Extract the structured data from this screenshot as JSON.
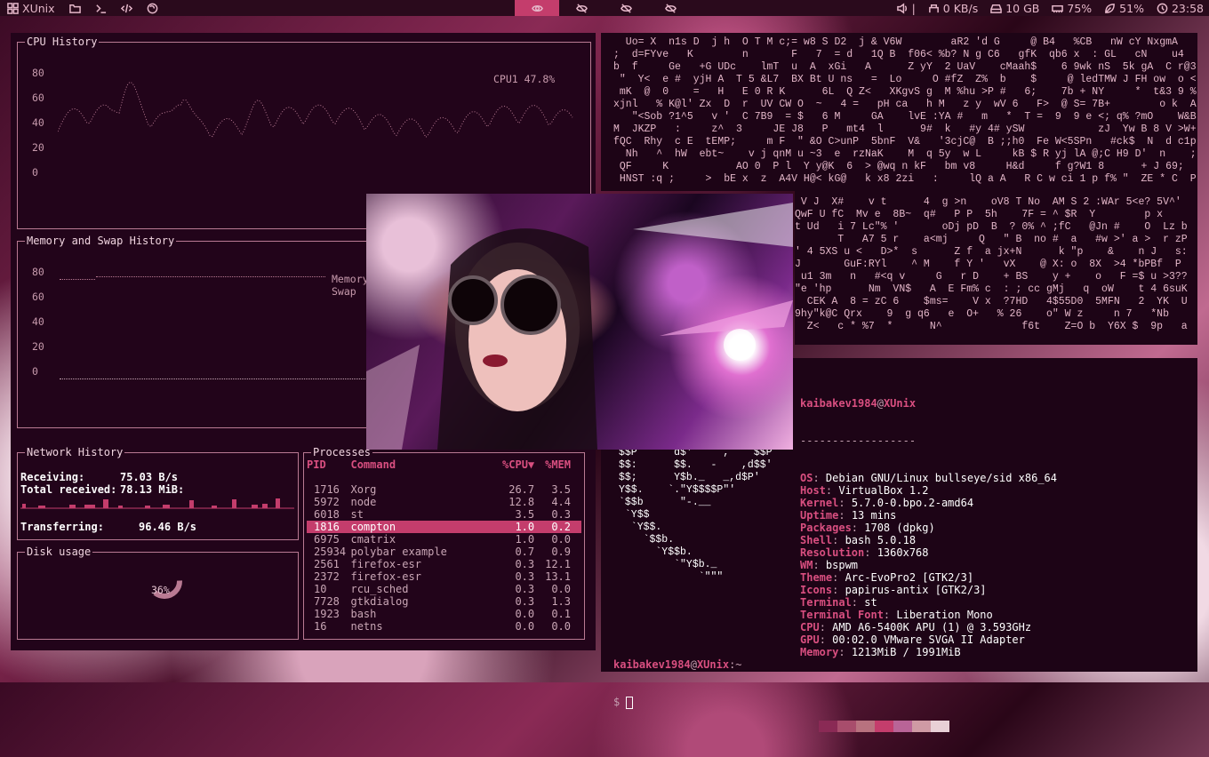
{
  "topbar": {
    "app_name": "XUnix",
    "right": {
      "volume_sep": "|",
      "net": "0 KB/s",
      "disk": "10 GB",
      "mem": "75%",
      "cpu": "51%",
      "clock": "23:58"
    }
  },
  "cpu": {
    "title": "CPU History",
    "label": "CPU1  47.8%",
    "yticks": [
      "80",
      "60",
      "40",
      "20",
      "0"
    ]
  },
  "memory": {
    "title": "Memory and Swap History",
    "legend_memory": "Memory",
    "legend_swap": "Swap",
    "yticks": [
      "80",
      "60",
      "40",
      "20",
      "0"
    ]
  },
  "network": {
    "title": "Network History",
    "receiving_label": "Receiving:",
    "receiving_value": "75.03  B/s",
    "total_label": "Total received:",
    "total_value": "78.13 MiB:",
    "transferring_label": "Transferring:",
    "transferring_value": "96.46  B/s"
  },
  "disk": {
    "title": "Disk usage",
    "percent": "36%"
  },
  "processes": {
    "title": "Processes",
    "headers": {
      "pid": "PID",
      "cmd": "Command",
      "cpu": "%CPU▼",
      "mem": "%MEM"
    },
    "rows": [
      {
        "pid": "1716",
        "cmd": "Xorg",
        "cpu": "26.7",
        "mem": "3.5"
      },
      {
        "pid": "5972",
        "cmd": "node",
        "cpu": "12.8",
        "mem": "4.4"
      },
      {
        "pid": "6018",
        "cmd": "st",
        "cpu": "3.5",
        "mem": "0.3"
      },
      {
        "pid": "1816",
        "cmd": "compton",
        "cpu": "1.0",
        "mem": "0.2",
        "selected": true
      },
      {
        "pid": "6975",
        "cmd": "cmatrix",
        "cpu": "1.0",
        "mem": "0.0"
      },
      {
        "pid": "25934",
        "cmd": "polybar example",
        "cpu": "0.7",
        "mem": "0.9"
      },
      {
        "pid": "2561",
        "cmd": "firefox-esr",
        "cpu": "0.3",
        "mem": "12.1"
      },
      {
        "pid": "2372",
        "cmd": "firefox-esr",
        "cpu": "0.3",
        "mem": "13.1"
      },
      {
        "pid": "10",
        "cmd": "rcu_sched",
        "cpu": "0.3",
        "mem": "0.0"
      },
      {
        "pid": "7728",
        "cmd": "gtkdialog",
        "cpu": "0.3",
        "mem": "1.3"
      },
      {
        "pid": "1923",
        "cmd": "bash",
        "cpu": "0.0",
        "mem": "0.1"
      },
      {
        "pid": "16",
        "cmd": "netns",
        "cpu": "0.0",
        "mem": "0.0"
      }
    ]
  },
  "neofetch": {
    "user": "kaibakev1984",
    "at": "@",
    "host": "XUnix",
    "sep": "------------------",
    "lines": [
      {
        "k": "OS",
        "v": "Debian GNU/Linux bullseye/sid x86_64"
      },
      {
        "k": "Host",
        "v": "VirtualBox 1.2"
      },
      {
        "k": "Kernel",
        "v": "5.7.0-0.bpo.2-amd64"
      },
      {
        "k": "Uptime",
        "v": "13 mins"
      },
      {
        "k": "Packages",
        "v": "1708 (dpkg)"
      },
      {
        "k": "Shell",
        "v": "bash 5.0.18"
      },
      {
        "k": "Resolution",
        "v": "1360x768"
      },
      {
        "k": "WM",
        "v": "bspwm"
      },
      {
        "k": "Theme",
        "v": "Arc-EvoPro2 [GTK2/3]"
      },
      {
        "k": "Icons",
        "v": "papirus-antix [GTK2/3]"
      },
      {
        "k": "Terminal",
        "v": "st"
      },
      {
        "k": "Terminal Font",
        "v": "Liberation Mono"
      },
      {
        "k": "CPU",
        "v": "AMD A6-5400K APU (1) @ 3.593GHz"
      },
      {
        "k": "GPU",
        "v": "00:02.0 VMware SVGA II Adapter"
      },
      {
        "k": "Memory",
        "v": "1213MiB / 1991MiB"
      }
    ],
    "swatches": [
      "#8a2a55",
      "#a84d6c",
      "#b8727f",
      "#c43d6c",
      "#b96497",
      "#cf9aa4",
      "#e8d0d6"
    ],
    "prompt_user": "kaibakev1984",
    "prompt_host": "XUnix",
    "prompt_path": ":~",
    "prompt_symbol": "$"
  }
}
